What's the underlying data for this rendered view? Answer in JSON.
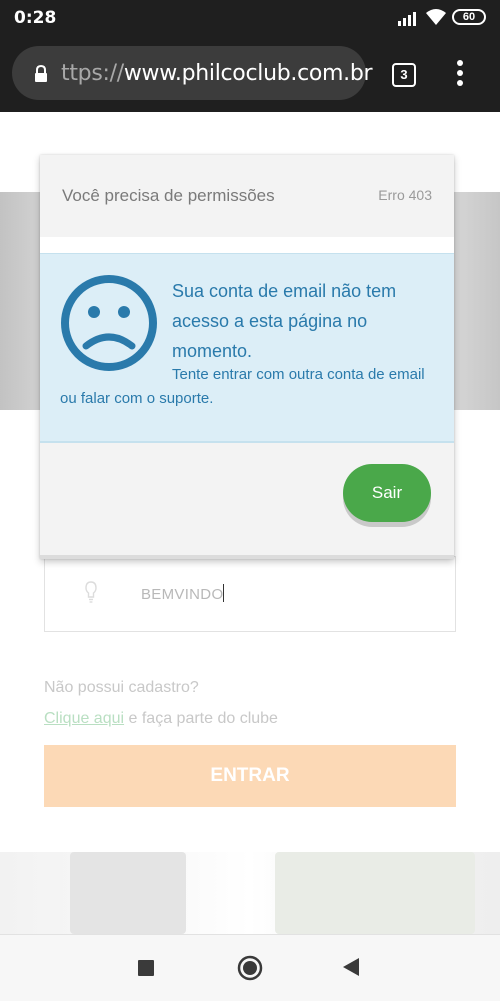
{
  "status_bar": {
    "time": "0:28",
    "battery": "60"
  },
  "browser": {
    "url_prefix": "ttps://",
    "url_host": "www.philcoclub.com.br",
    "tab_count": "3"
  },
  "login": {
    "username_value": "BEMVINDO",
    "no_account_text": "Não possui cadastro?",
    "signup_link": "Clique aqui",
    "signup_suffix": " e faça parte do clube",
    "enter_label": "ENTRAR"
  },
  "modal": {
    "title": "Você precisa de permissões",
    "error_code": "Erro 403",
    "message_main": "Sua conta de email não tem acesso a esta página no momento.",
    "message_sub": "Tente entrar com outra conta de email ou falar com o suporte.",
    "exit_label": "Sair"
  },
  "colors": {
    "info_text": "#2a7aab",
    "info_bg": "#dceef7",
    "exit_button": "#4aa84a",
    "enter_button": "#fcd9b6"
  },
  "icons": [
    "signal-icon",
    "wifi-icon",
    "battery-icon",
    "lock-icon",
    "tabs-icon",
    "more-menu-icon",
    "sad-face-icon",
    "bulb-icon",
    "nav-recents-icon",
    "nav-home-icon",
    "nav-back-icon"
  ]
}
